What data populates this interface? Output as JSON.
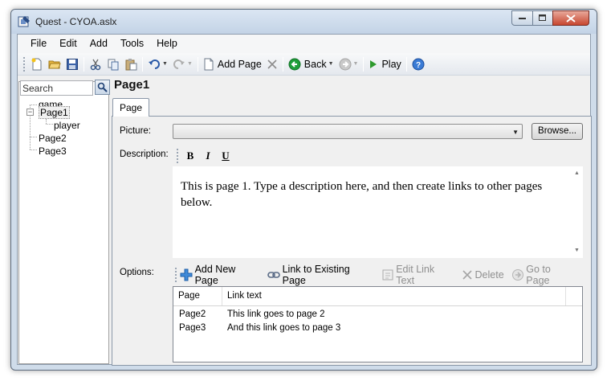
{
  "window": {
    "title": "Quest - CYOA.aslx"
  },
  "menu": [
    "File",
    "Edit",
    "Add",
    "Tools",
    "Help"
  ],
  "toolbar": {
    "add_page": "Add Page",
    "back": "Back",
    "play": "Play"
  },
  "search": {
    "placeholder": "Search"
  },
  "tree": {
    "items": [
      {
        "label": "game"
      },
      {
        "label": "Page1",
        "expanded": true
      },
      {
        "label": "player"
      },
      {
        "label": "Page2"
      },
      {
        "label": "Page3"
      }
    ]
  },
  "editor": {
    "title": "Page1",
    "tab": "Page",
    "picture_label": "Picture:",
    "picture_value": "",
    "browse_label": "Browse...",
    "description_label": "Description:",
    "format": {
      "bold": "B",
      "italic": "I",
      "underline": "U"
    },
    "description_text": "This is page 1. Type a description here, and then create links to other pages below.",
    "options_label": "Options:",
    "options_toolbar": {
      "add_new_page": "Add New Page",
      "link_existing": "Link to Existing Page",
      "edit_link_text": "Edit Link Text",
      "delete": "Delete",
      "go_to_page": "Go to Page"
    },
    "links": {
      "columns": [
        "Page",
        "Link text"
      ],
      "rows": [
        {
          "page": "Page2",
          "text": "This link goes to page 2"
        },
        {
          "page": "Page3",
          "text": "And this link goes to page 3"
        }
      ]
    }
  },
  "colors": {
    "accent": "#3a7bd5",
    "play_green": "#2e9a2e",
    "back_green": "#1f9e3a"
  }
}
